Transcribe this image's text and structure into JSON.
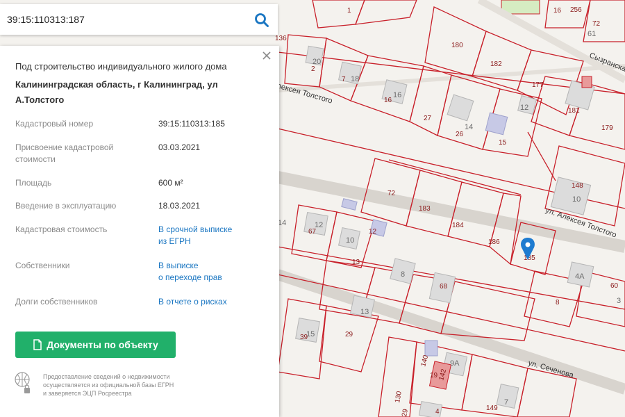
{
  "search": {
    "value": "39:15:110313:187"
  },
  "panel": {
    "purpose": "Под строительство индивидуального жилого дома",
    "address_line1": "Калининградская область, г Калининград, ул",
    "address_line2": "А.Толстого",
    "rows": [
      {
        "label": "Кадастровый номер",
        "value": "39:15:110313:185"
      },
      {
        "label1": "Присвоение кадастровой",
        "label2": "стоимости",
        "value": "03.03.2021"
      },
      {
        "label": "Площадь",
        "value": "600 м²"
      },
      {
        "label": "Введение в эксплуатацию",
        "value": "18.03.2021"
      },
      {
        "label": "Кадастровая стоимость",
        "link1": "В срочной выписке",
        "link2": "из ЕГРН"
      },
      {
        "label": "Собственники",
        "link1": "В выписке",
        "link2": "о переходе прав"
      },
      {
        "label": "Долги собственников",
        "link1": "В отчете о рисках"
      }
    ],
    "doc_button": "Документы по объекту",
    "footer": {
      "line1": "Предоставление сведений о недвижимости",
      "line2": "осуществляется из официальной базы ЕГРН",
      "line3": "и заверяется ЭЦП Росреестра"
    }
  },
  "map": {
    "streets": [
      "ул. Алексея Толстого",
      "ул. Сеченова",
      "Сызранская",
      "Алексея Толстого"
    ],
    "parcel_numbers": [
      "1",
      "136",
      "20",
      "2",
      "7",
      "18",
      "16",
      "16",
      "180",
      "182",
      "177",
      "12",
      "181",
      "179",
      "256",
      "16",
      "72",
      "61",
      "27",
      "26",
      "14",
      "15",
      "72",
      "183",
      "184",
      "186",
      "148",
      "10",
      "14",
      "12",
      "67",
      "12",
      "10",
      "13",
      "8",
      "68",
      "185",
      "4А",
      "60",
      "8",
      "13",
      "15",
      "39",
      "29",
      "140",
      "9А",
      "19",
      "142",
      "130",
      "29",
      "4",
      "149",
      "7",
      "3"
    ],
    "colors": {
      "parcel_line": "#c8202a",
      "map_bg": "#f4f2ee",
      "accent": "#1a76c2",
      "button": "#21b06a",
      "pin": "#1e7bd0"
    }
  }
}
